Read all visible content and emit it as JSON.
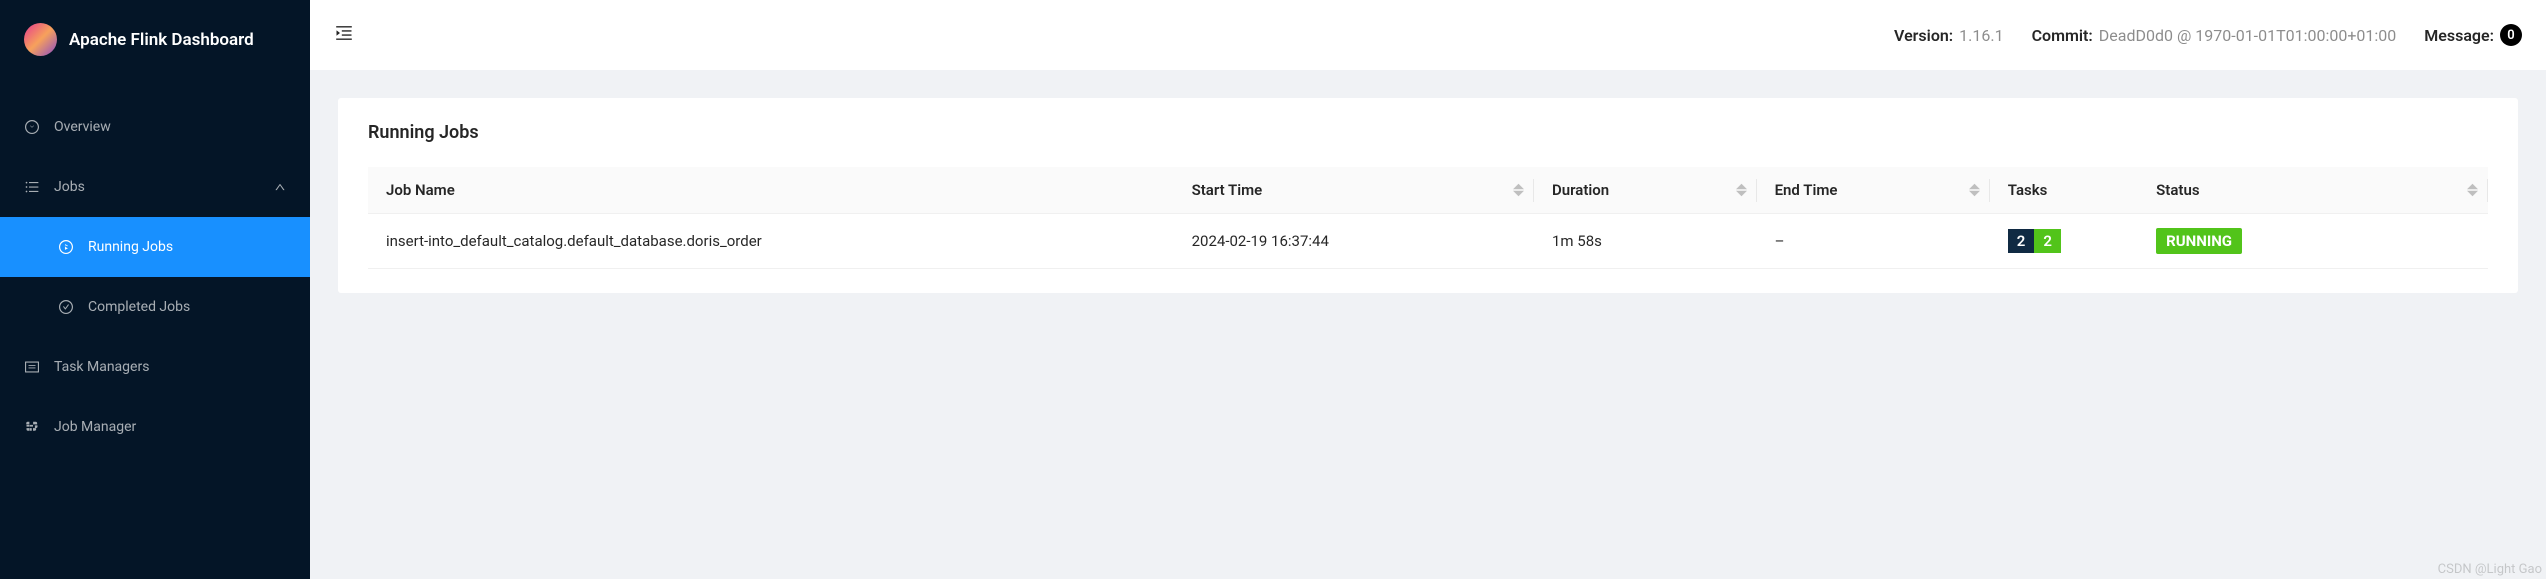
{
  "brand": {
    "title": "Apache Flink Dashboard"
  },
  "sidebar": {
    "items": [
      {
        "label": "Overview"
      },
      {
        "label": "Jobs"
      },
      {
        "label": "Task Managers"
      },
      {
        "label": "Job Manager"
      }
    ],
    "jobsSubmenu": [
      {
        "label": "Running Jobs"
      },
      {
        "label": "Completed Jobs"
      }
    ]
  },
  "header": {
    "versionLabel": "Version:",
    "version": "1.16.1",
    "commitLabel": "Commit:",
    "commit": "DeadD0d0 @ 1970-01-01T01:00:00+01:00",
    "messageLabel": "Message:",
    "messageCount": "0"
  },
  "page": {
    "title": "Running Jobs"
  },
  "table": {
    "columns": {
      "jobName": "Job Name",
      "startTime": "Start Time",
      "duration": "Duration",
      "endTime": "End Time",
      "tasks": "Tasks",
      "status": "Status"
    },
    "rows": [
      {
        "jobName": "insert-into_default_catalog.default_database.doris_order",
        "startTime": "2024-02-19 16:37:44",
        "duration": "1m 58s",
        "endTime": "–",
        "tasksTotal": "2",
        "tasksRunning": "2",
        "status": "RUNNING"
      }
    ]
  },
  "watermark": "CSDN @Light Gao"
}
